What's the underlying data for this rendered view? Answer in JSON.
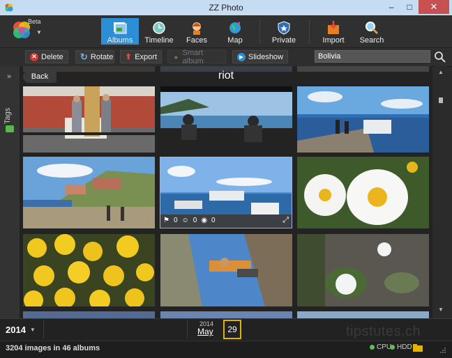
{
  "window": {
    "title": "ZZ Photo"
  },
  "branding": {
    "badge": "Beta"
  },
  "nav": {
    "albums": "Albums",
    "timeline": "Timeline",
    "faces": "Faces",
    "map": "Map",
    "private": "Private",
    "import": "Import",
    "search": "Search"
  },
  "actions": {
    "delete": "Delete",
    "rotate": "Rotate",
    "export": "Export",
    "smart_album": "Smart album",
    "slideshow": "Slideshow"
  },
  "search": {
    "value": "Bolivia"
  },
  "left_panel": {
    "tags_label": "Tags"
  },
  "album": {
    "back_label": "Back",
    "title": "riot"
  },
  "photo_overlay": {
    "tags_count": "0",
    "faces_count": "0",
    "places_count": "0"
  },
  "timeline": {
    "year": "2014",
    "month_year": "2014",
    "month": "May",
    "day": "29"
  },
  "status": {
    "text": "3204 images in 46 albums",
    "cpu": "CPU",
    "hdd": "HDD"
  },
  "watermark": "tipstutes.ch",
  "colors": {
    "accent": "#2c8fd6",
    "status_ok": "#5cc14f",
    "day_highlight": "#e2b400"
  }
}
